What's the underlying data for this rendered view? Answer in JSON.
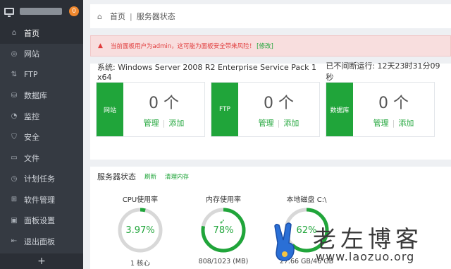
{
  "sidebar": {
    "badge": "0",
    "items": [
      {
        "label": "首页",
        "icon": "home-icon",
        "glyph": "⌂",
        "active": true
      },
      {
        "label": "网站",
        "icon": "globe-icon",
        "glyph": "◎",
        "active": false
      },
      {
        "label": "FTP",
        "icon": "ftp-icon",
        "glyph": "⇅",
        "active": false
      },
      {
        "label": "数据库",
        "icon": "database-icon",
        "glyph": "⛁",
        "active": false
      },
      {
        "label": "监控",
        "icon": "monitor-icon",
        "glyph": "◔",
        "active": false
      },
      {
        "label": "安全",
        "icon": "shield-icon",
        "glyph": "⛉",
        "active": false
      },
      {
        "label": "文件",
        "icon": "folder-icon",
        "glyph": "▭",
        "active": false
      },
      {
        "label": "计划任务",
        "icon": "clock-icon",
        "glyph": "◷",
        "active": false
      },
      {
        "label": "软件管理",
        "icon": "grid-icon",
        "glyph": "⊞",
        "active": false
      },
      {
        "label": "面板设置",
        "icon": "settings-icon",
        "glyph": "▣",
        "active": false
      },
      {
        "label": "退出面板",
        "icon": "logout-icon",
        "glyph": "⇤",
        "active": false
      }
    ],
    "add_label": "+"
  },
  "breadcrumb": {
    "home": "首页",
    "current": "服务器状态"
  },
  "alert": {
    "text": "当前面板用户为admin，这可能为面板安全带来风险！",
    "fix": "[修改]"
  },
  "system": {
    "os": "系统: Windows Server 2008 R2 Enterprise Service Pack 1 x64",
    "uptime": "已不间断运行: 12天23时31分09秒"
  },
  "tiles": [
    {
      "title": "网站",
      "count": "0 个",
      "manage": "管理",
      "add": "添加"
    },
    {
      "title": "FTP",
      "count": "0 个",
      "manage": "管理",
      "add": "添加"
    },
    {
      "title": "数据库",
      "count": "0 个",
      "manage": "管理",
      "add": "添加"
    }
  ],
  "status": {
    "title": "服务器状态",
    "refresh": "刷新",
    "clear": "清理内存",
    "gauges": [
      {
        "label": "CPU使用率",
        "value": "3.97%",
        "percent": 3.97,
        "sub": "1 核心"
      },
      {
        "label": "内存使用率",
        "value": "78%",
        "percent": 78,
        "sub": "808/1023 (MB)"
      },
      {
        "label": "本地磁盘 C:\\",
        "value": "62%",
        "percent": 62,
        "sub": "27.66 GB/46 GB"
      }
    ]
  },
  "watermark": {
    "brand": "老左博客",
    "url": "www.laozuo.org"
  },
  "colors": {
    "accent": "#20a53a",
    "sidebar": "#353a42",
    "alert": "#e03b3b",
    "badge": "#f0882e"
  }
}
